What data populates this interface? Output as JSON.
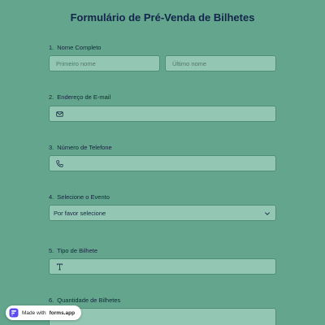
{
  "form": {
    "title": "Formulário de Pré-Venda de Bilhetes",
    "questions": [
      {
        "number": "1.",
        "label": "Nome Completo",
        "first_placeholder": "Primeiro nome",
        "last_placeholder": "Último nome"
      },
      {
        "number": "2.",
        "label": "Endereço de E-mail",
        "icon": "mail-icon"
      },
      {
        "number": "3.",
        "label": "Número de Telefone",
        "icon": "phone-icon"
      },
      {
        "number": "4.",
        "label": "Selecione o Evento",
        "selected": "Por favor selecione"
      },
      {
        "number": "5.",
        "label": "Tipo de Bilhete",
        "icon": "text-icon"
      },
      {
        "number": "6.",
        "label": "Quantidade de Bilhetes"
      }
    ]
  },
  "badge": {
    "prefix": "Made with",
    "brand": "forms.app"
  },
  "colors": {
    "background": "#64a58d",
    "field": "#93c7b4",
    "field_border": "#4f8f78",
    "title": "#13254a"
  }
}
